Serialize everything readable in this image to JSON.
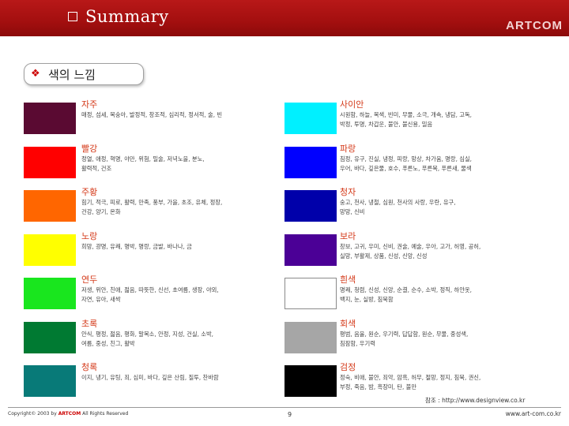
{
  "header": {
    "title": "Summary",
    "brand": "ARTCOM"
  },
  "section_title": "색의 느낌",
  "colors": {
    "left": [
      {
        "name": "자주",
        "swatch": "#5a0a32",
        "desc": [
          "매정, 섬세, 복숭아, 발정적, 창조적, 심리적, 정서적, 술, 빈"
        ]
      },
      {
        "name": "빨강",
        "swatch": "#ff0000",
        "desc": [
          "정열, 애정, 혁명, 야만, 위험, 밀술, 저녁노을, 분노,",
          "활력적, 건조"
        ]
      },
      {
        "name": "주황",
        "swatch": "#ff6600",
        "desc": [
          "힘기, 적극, 피로, 활력, 만족, 풍부, 가을, 초조, 유체, 정장,",
          "건강, 양기, 온화"
        ]
      },
      {
        "name": "노랑",
        "swatch": "#ffff00",
        "desc": [
          "희망, 광명, 유쾌, 명박, 명랑, 금발, 바나나, 금"
        ]
      },
      {
        "name": "연두",
        "swatch": "#19e61e",
        "desc": [
          "저생, 위안, 친애, 젊음, 따뜻한, 신선, 초여름, 생장, 야외,",
          "자연, 유아, 새싹"
        ]
      },
      {
        "name": "초록",
        "swatch": "#007a32",
        "desc": [
          "안식, 평정, 젊음, 평화, 말목소, 안정, 지성, 건실, 소박,",
          "여름, 중성, 친그, 활박"
        ]
      },
      {
        "name": "청록",
        "swatch": "#087a78",
        "desc": [
          "이지, 냉기, 유팅, 죄, 심미, 바다, 깊은 산림, 질투, 찬바람"
        ]
      }
    ],
    "right": [
      {
        "name": "사이안",
        "swatch": "#00f0ff",
        "desc": [
          "시원함, 하늘, 목색, 빈미, 무물, 소극, 개속, 냉담, 고독,",
          "박정, 투명, 차갑운, 불안, 불신용, 밀음"
        ]
      },
      {
        "name": "파랑",
        "swatch": "#0000ff",
        "desc": [
          "침정, 유구, 진실, 냉정, 피랑, 망상, 차가움, 명랑, 심실,",
          "우어, 바다, 깊은물, 호수, 푸른노, 푸른목, 푸른새, 물색"
        ]
      },
      {
        "name": "청자",
        "swatch": "#0000aa",
        "desc": [
          "숭고, 천사, 냉철, 심원, 천사의 사랑, 우란, 유구,",
          "망망, 신비"
        ]
      },
      {
        "name": "보라",
        "swatch": "#4b0096",
        "desc": [
          "창보, 고귀, 우미, 신비, 권술, 예술, 우아, 고가, 허영, 공허,",
          "실망, 부활제, 상품, 신성, 신앙, 신성"
        ]
      },
      {
        "name": "흰색",
        "swatch": "#ffffff",
        "desc": [
          "명쾌, 청렴, 신성, 신앙, 순결, 순수, 소박, 정직, 하얀옷,",
          "백지, 눈, 실방, 침묵함"
        ]
      },
      {
        "name": "회색",
        "swatch": "#a6a6a6",
        "desc": [
          "평범, 음울, 원순, 우기력, 답답함, 원순, 무물, 중성색,",
          "침잠함, 우기력"
        ]
      },
      {
        "name": "검정",
        "swatch": "#000000",
        "desc": [
          "정숙, 비애, 불안, 죄악, 암흑, 허무, 절망, 정지, 침묵, 권신,",
          "부정, 죽음, 밤, 흑장미, 탄, 불만"
        ]
      }
    ]
  },
  "source_note": "참조 : http://www.designview.co.kr",
  "footer": {
    "copyright_pre": "Copyright© 2003 by",
    "company": "ARTCOM",
    "copyright_post": "All Rights Reserved",
    "page": "9",
    "url": "www.art-com.co.kr"
  }
}
